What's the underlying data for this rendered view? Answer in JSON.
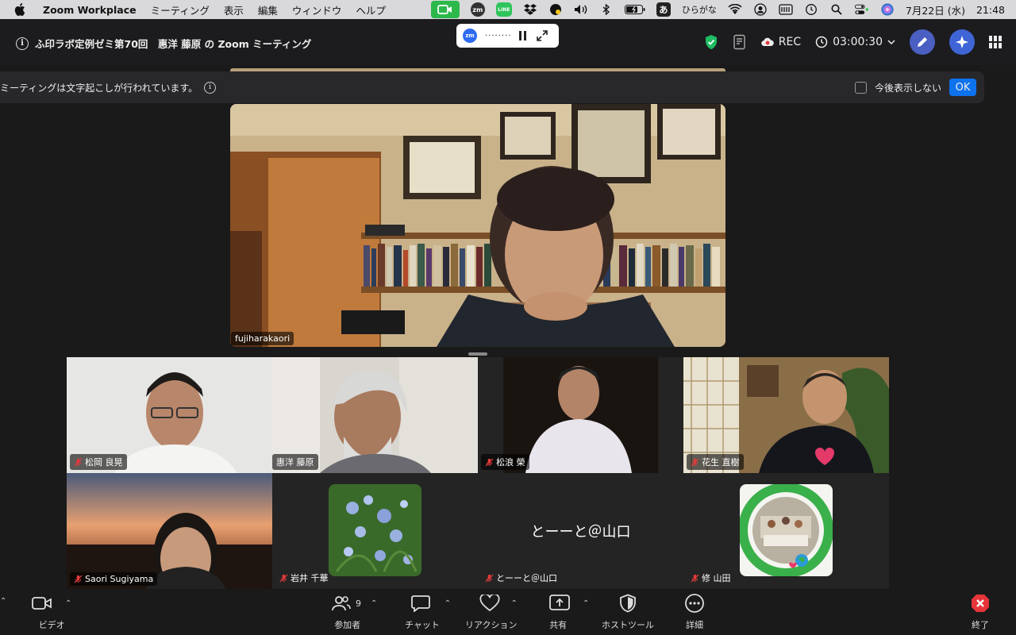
{
  "menubar": {
    "app_name": "Zoom Workplace",
    "menus": [
      "ミーティング",
      "表示",
      "編集",
      "ウィンドウ",
      "ヘルプ"
    ],
    "input_method_badge": "あ",
    "input_method": "ひらがな",
    "zm_label": "zm",
    "line_label": "LINE",
    "date": "7月22日 (水)",
    "time": "21:48"
  },
  "topbar": {
    "meeting_title": "ふ印ラボ定例ゼミ第70回　惠洋 藤原 の Zoom ミーティング",
    "pill_logo": "zm",
    "rec_label": "REC",
    "timer": "03:00:30"
  },
  "banner": {
    "message": "ミーティングは文字起こしが行われています。",
    "dont_show": "今後表示しない",
    "ok": "OK"
  },
  "main_video": {
    "name": "fujiharakaori"
  },
  "gallery": {
    "tiles": [
      {
        "name": "松岡 良晃",
        "muted": true
      },
      {
        "name": "惠洋 藤原",
        "muted": false
      },
      {
        "name": "松浪 榮",
        "muted": true
      },
      {
        "name": "花生 直樹",
        "muted": true
      },
      {
        "name": "Saori Sugiyama",
        "muted": true
      },
      {
        "name": "岩井 千華",
        "muted": true
      },
      {
        "name": "とーーと＠山口",
        "muted": true,
        "display_name": "とーーと＠山口"
      },
      {
        "name": "修 山田",
        "muted": true
      }
    ],
    "climate_logo_text": "ACCIÓN CLIMÁTICA · AKSI IKLIM · ACTION CLIMATIQUE · CLIMATE ACTION"
  },
  "toolbar": {
    "video": "ビデオ",
    "participants": "参加者",
    "participants_count": "9",
    "chat": "チャット",
    "reactions": "リアクション",
    "share": "共有",
    "host_tools": "ホストツール",
    "more": "詳細",
    "end": "終了"
  }
}
